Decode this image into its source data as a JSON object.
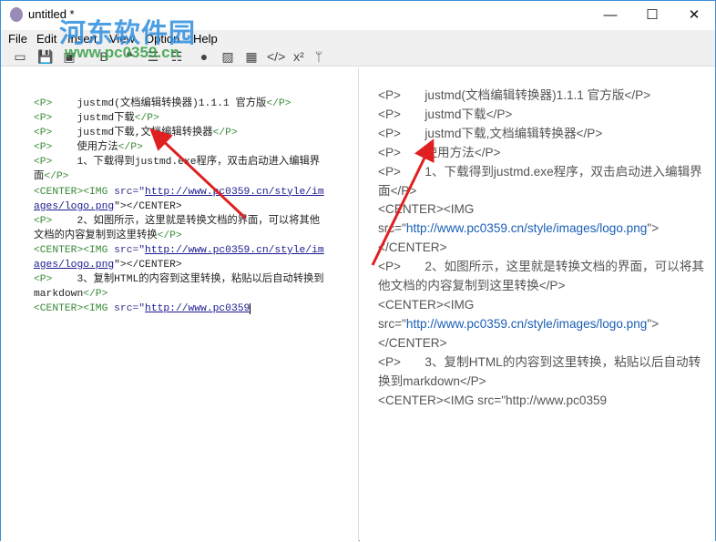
{
  "window": {
    "title": "untitled *",
    "minimize": "—",
    "maximize": "☐",
    "close": "✕"
  },
  "watermark": {
    "name": "河东软件园",
    "url": "www.pc0359.cn"
  },
  "menu": [
    "File",
    "Edit",
    "Insert",
    "View",
    "Option",
    "Help"
  ],
  "toolbar": [
    {
      "name": "open-icon",
      "glyph": "▭"
    },
    {
      "name": "save-icon",
      "glyph": "💾"
    },
    {
      "name": "save-as-icon",
      "glyph": "▣"
    },
    {
      "name": "bold-icon",
      "glyph": "B"
    },
    {
      "name": "quote-icon",
      "glyph": "❝"
    },
    {
      "name": "bullet-list-icon",
      "glyph": "☰"
    },
    {
      "name": "numbered-list-icon",
      "glyph": "☷"
    },
    {
      "name": "link-icon",
      "glyph": "●"
    },
    {
      "name": "image-icon",
      "glyph": "▨"
    },
    {
      "name": "table-icon",
      "glyph": "▦"
    },
    {
      "name": "code-icon",
      "glyph": "</>"
    },
    {
      "name": "superscript-icon",
      "glyph": "x²"
    },
    {
      "name": "branch-icon",
      "glyph": "ᛘ"
    }
  ],
  "editor_lines": [
    [
      {
        "t": "<P>",
        "c": "tag"
      },
      {
        "t": "    justmd(文档编辑转换器)1.1.1 官方版",
        "c": ""
      },
      {
        "t": "</P>",
        "c": "tag"
      }
    ],
    [
      {
        "t": "<P>",
        "c": "tag"
      },
      {
        "t": "    justmd下载",
        "c": ""
      },
      {
        "t": "</P>",
        "c": "tag"
      }
    ],
    [
      {
        "t": "<P>",
        "c": "tag"
      },
      {
        "t": "    justmd下载,文档编辑转换器",
        "c": ""
      },
      {
        "t": "</P>",
        "c": "tag"
      }
    ],
    [
      {
        "t": "<P>",
        "c": "tag"
      },
      {
        "t": "    使用方法",
        "c": ""
      },
      {
        "t": "</P>",
        "c": "tag"
      }
    ],
    [
      {
        "t": "<P>",
        "c": "tag"
      },
      {
        "t": "    1、下载得到justmd.exe程序，双击启动进入编辑界面",
        "c": ""
      },
      {
        "t": "</P>",
        "c": "tag"
      }
    ],
    [
      {
        "t": "<CENTER><IMG ",
        "c": "tag"
      },
      {
        "t": "src=\"",
        "c": "attr"
      },
      {
        "t": "http://www.pc0359.cn/style/images/logo.png",
        "c": "url"
      },
      {
        "t": "\"></CENTER>",
        "c": ""
      }
    ],
    [
      {
        "t": "<P>",
        "c": "tag"
      },
      {
        "t": "    2、如图所示，这里就是转换文档的界面，可以将其他文档的内容复制到这里转换",
        "c": ""
      },
      {
        "t": "</P>",
        "c": "tag"
      }
    ],
    [
      {
        "t": "<CENTER><IMG ",
        "c": "tag"
      },
      {
        "t": "src=\"",
        "c": "attr"
      },
      {
        "t": "http://www.pc0359.cn/style/images/logo.png",
        "c": "url"
      },
      {
        "t": "\"></CENTER>",
        "c": ""
      }
    ],
    [
      {
        "t": "<P>",
        "c": "tag"
      },
      {
        "t": "    3、复制HTML的内容到这里转换，粘贴以后自动转换到markdown",
        "c": ""
      },
      {
        "t": "</P>",
        "c": "tag"
      }
    ],
    [
      {
        "t": "<CENTER><IMG ",
        "c": "tag"
      },
      {
        "t": "src=\"",
        "c": "attr"
      },
      {
        "t": "http://www.pc0359",
        "c": "url caret"
      }
    ]
  ],
  "preview_lines": [
    [
      {
        "t": "<P>       justmd(文档编辑转换器)1.1.1 官方版</P>",
        "c": ""
      }
    ],
    [
      {
        "t": "<P>       justmd下载</P>",
        "c": ""
      }
    ],
    [
      {
        "t": "<P>       justmd下载,文档编辑转换器</P>",
        "c": ""
      }
    ],
    [
      {
        "t": "<P>       使用方法</P>",
        "c": ""
      }
    ],
    [
      {
        "t": "<P>       1、下载得到justmd.exe程序，双击启动进入编辑界面</P>",
        "c": ""
      }
    ],
    [
      {
        "t": "<CENTER><IMG src=\"",
        "c": ""
      },
      {
        "t": "http://www.pc0359.cn/style/images/logo.png",
        "c": "plink"
      },
      {
        "t": "\"></CENTER>",
        "c": ""
      }
    ],
    [
      {
        "t": "<P>       2、如图所示，这里就是转换文档的界面，可以将其他文档的内容复制到这里转换</P>",
        "c": ""
      }
    ],
    [
      {
        "t": "<CENTER><IMG src=\"",
        "c": ""
      },
      {
        "t": "http://www.pc0359.cn/style/images/logo.png",
        "c": "plink"
      },
      {
        "t": "\"></CENTER>",
        "c": ""
      }
    ],
    [
      {
        "t": "<P>       3、复制HTML的内容到这里转换，粘贴以后自动转换到markdown</P>",
        "c": ""
      }
    ],
    [
      {
        "t": "<CENTER><IMG src=\"http://www.pc0359",
        "c": ""
      }
    ]
  ]
}
